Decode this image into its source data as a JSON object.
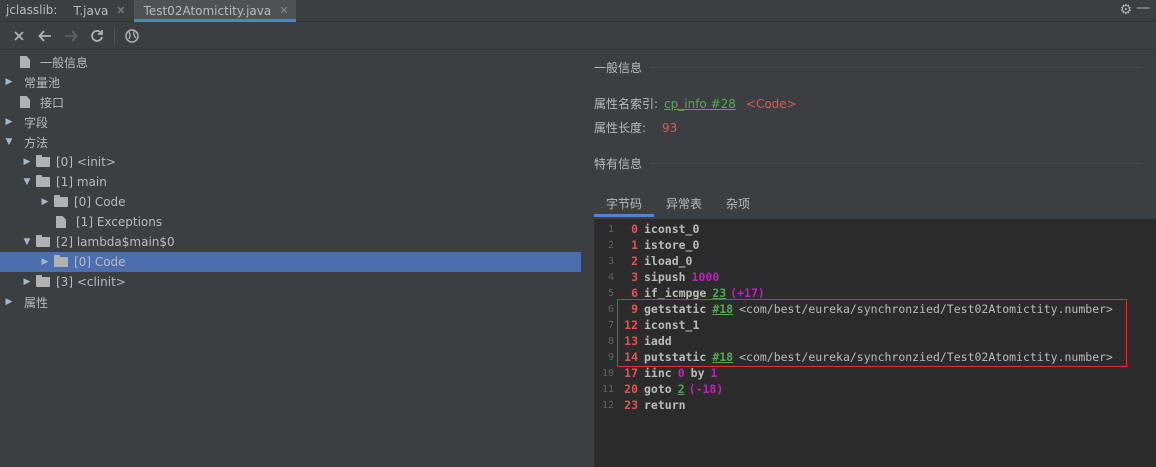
{
  "tabbar": {
    "app_label": "jclasslib:",
    "tabs": [
      {
        "label": "T.java",
        "close": "✕"
      },
      {
        "label": "Test02Atomictity.java",
        "close": "✕"
      }
    ],
    "settings_icon": "gear-icon",
    "minimize_label": "—"
  },
  "toolbar": {
    "buttons": [
      "close-icon",
      "back-icon",
      "forward-icon",
      "refresh-icon",
      "web-icon"
    ]
  },
  "tree": {
    "items": [
      {
        "label": "一般信息",
        "icon": "file-icon"
      },
      {
        "label": "常量池",
        "icon": "expand-arrow"
      },
      {
        "label": "接口",
        "icon": "file-icon"
      },
      {
        "label": "字段",
        "icon": "expand-arrow"
      },
      {
        "label": "方法",
        "icon": "collapse-arrow"
      },
      {
        "label": "[0] <init>",
        "icon": "folder-icon"
      },
      {
        "label": "[1] main",
        "icon": "folder-icon"
      },
      {
        "label": "[0] Code",
        "icon": "folder-icon"
      },
      {
        "label": "[1] Exceptions",
        "icon": "file-icon"
      },
      {
        "label": "[2] lambda$main$0",
        "icon": "folder-icon"
      },
      {
        "label": "[0] Code",
        "icon": "folder-icon"
      },
      {
        "label": "[3] <clinit>",
        "icon": "folder-icon"
      },
      {
        "label": "属性",
        "icon": "expand-arrow"
      }
    ]
  },
  "general": {
    "section_title": "一般信息",
    "attr_name_label": "属性名索引:",
    "attr_name_link": "cp_info #28",
    "attr_name_value": "<Code>",
    "attr_len_label": "属性长度:",
    "attr_len_value": "93"
  },
  "specific": {
    "section_title": "特有信息",
    "tabs": [
      "字节码",
      "异常表",
      "杂项"
    ]
  },
  "bytecode": [
    {
      "ln": "1",
      "off": "0",
      "op": "iconst_0"
    },
    {
      "ln": "2",
      "off": "1",
      "op": "istore_0"
    },
    {
      "ln": "3",
      "off": "2",
      "op": "iload_0"
    },
    {
      "ln": "4",
      "off": "3",
      "op": "sipush",
      "arg": "1000"
    },
    {
      "ln": "5",
      "off": "6",
      "op": "if_icmpge",
      "link": "23",
      "paren": "(+17)"
    },
    {
      "ln": "6",
      "off": "9",
      "op": "getstatic",
      "link": "#18",
      "cls": "<com/best/eureka/synchronzied/Test02Atomictity.number>"
    },
    {
      "ln": "7",
      "off": "12",
      "op": "iconst_1"
    },
    {
      "ln": "8",
      "off": "13",
      "op": "iadd"
    },
    {
      "ln": "9",
      "off": "14",
      "op": "putstatic",
      "link": "#18",
      "cls": "<com/best/eureka/synchronzied/Test02Atomictity.number>"
    },
    {
      "ln": "10",
      "off": "17",
      "op": "iinc",
      "arg": "0",
      "by": "by",
      "arg2": "1"
    },
    {
      "ln": "11",
      "off": "20",
      "op": "goto",
      "link": "2",
      "paren": "(-18)"
    },
    {
      "ln": "12",
      "off": "23",
      "op": "return"
    }
  ]
}
